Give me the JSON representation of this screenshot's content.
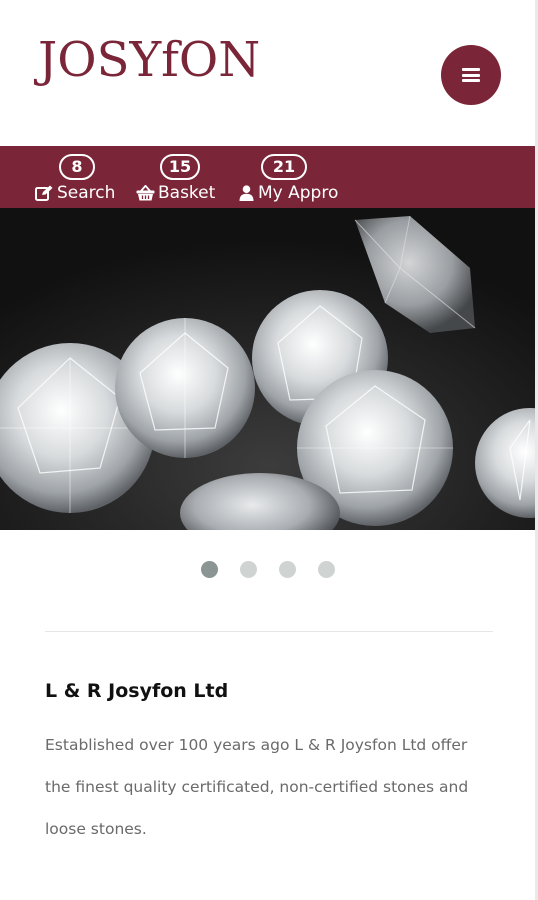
{
  "brand": {
    "logo_text": "JOSYfON",
    "accent_color": "#7a2638"
  },
  "header": {
    "menu_icon": "hamburger-menu-icon"
  },
  "nav": {
    "items": [
      {
        "label": "Search",
        "count": "8",
        "icon": "edit-icon"
      },
      {
        "label": "Basket",
        "count": "15",
        "icon": "basket-icon"
      },
      {
        "label": "My Appro",
        "count": "21",
        "icon": "user-icon"
      }
    ]
  },
  "carousel": {
    "slides": 4,
    "active_index": 0
  },
  "about": {
    "title": "L & R Josyfon Ltd",
    "description": "Established over 100 years ago L & R Joysfon Ltd offer the finest quality certificated, non-certified stones and loose stones."
  }
}
